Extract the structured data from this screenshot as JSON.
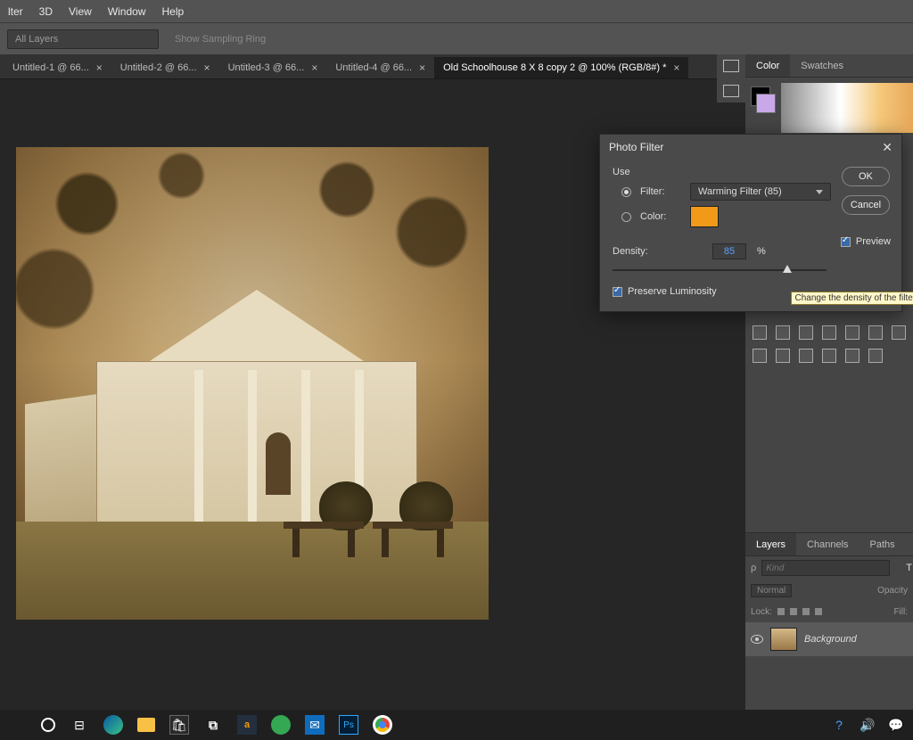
{
  "menu": [
    "lter",
    "3D",
    "View",
    "Window",
    "Help"
  ],
  "options": {
    "layers_field": "All Layers",
    "sampling": "Show Sampling Ring"
  },
  "tabs": [
    {
      "label": "Untitled-1 @ 66...",
      "active": false
    },
    {
      "label": "Untitled-2 @ 66...",
      "active": false
    },
    {
      "label": "Untitled-3 @ 66...",
      "active": false
    },
    {
      "label": "Untitled-4 @ 66...",
      "active": false
    },
    {
      "label": "Old Schoolhouse 8 X 8 copy 2 @ 100% (RGB/8#) *",
      "active": true
    }
  ],
  "color_panel": {
    "tabs": [
      "Color",
      "Swatches"
    ],
    "active": 0
  },
  "dialog": {
    "title": "Photo Filter",
    "group": "Use",
    "filter_label": "Filter:",
    "filter_value": "Warming Filter (85)",
    "color_label": "Color:",
    "color_swatch": "#f19a1a",
    "density_label": "Density:",
    "density_value": "85",
    "density_unit": "%",
    "preserve": "Preserve Luminosity",
    "ok": "OK",
    "cancel": "Cancel",
    "preview": "Preview",
    "tooltip": "Change the density of the filter effect.",
    "density_pct": 85
  },
  "layers_panel": {
    "tabs": [
      "Layers",
      "Channels",
      "Paths"
    ],
    "search_placeholder": "Kind",
    "blend": "Normal",
    "opacity_label": "Opacity",
    "lock_label": "Lock:",
    "fill_label": "Fill:",
    "layer_name": "Background"
  }
}
